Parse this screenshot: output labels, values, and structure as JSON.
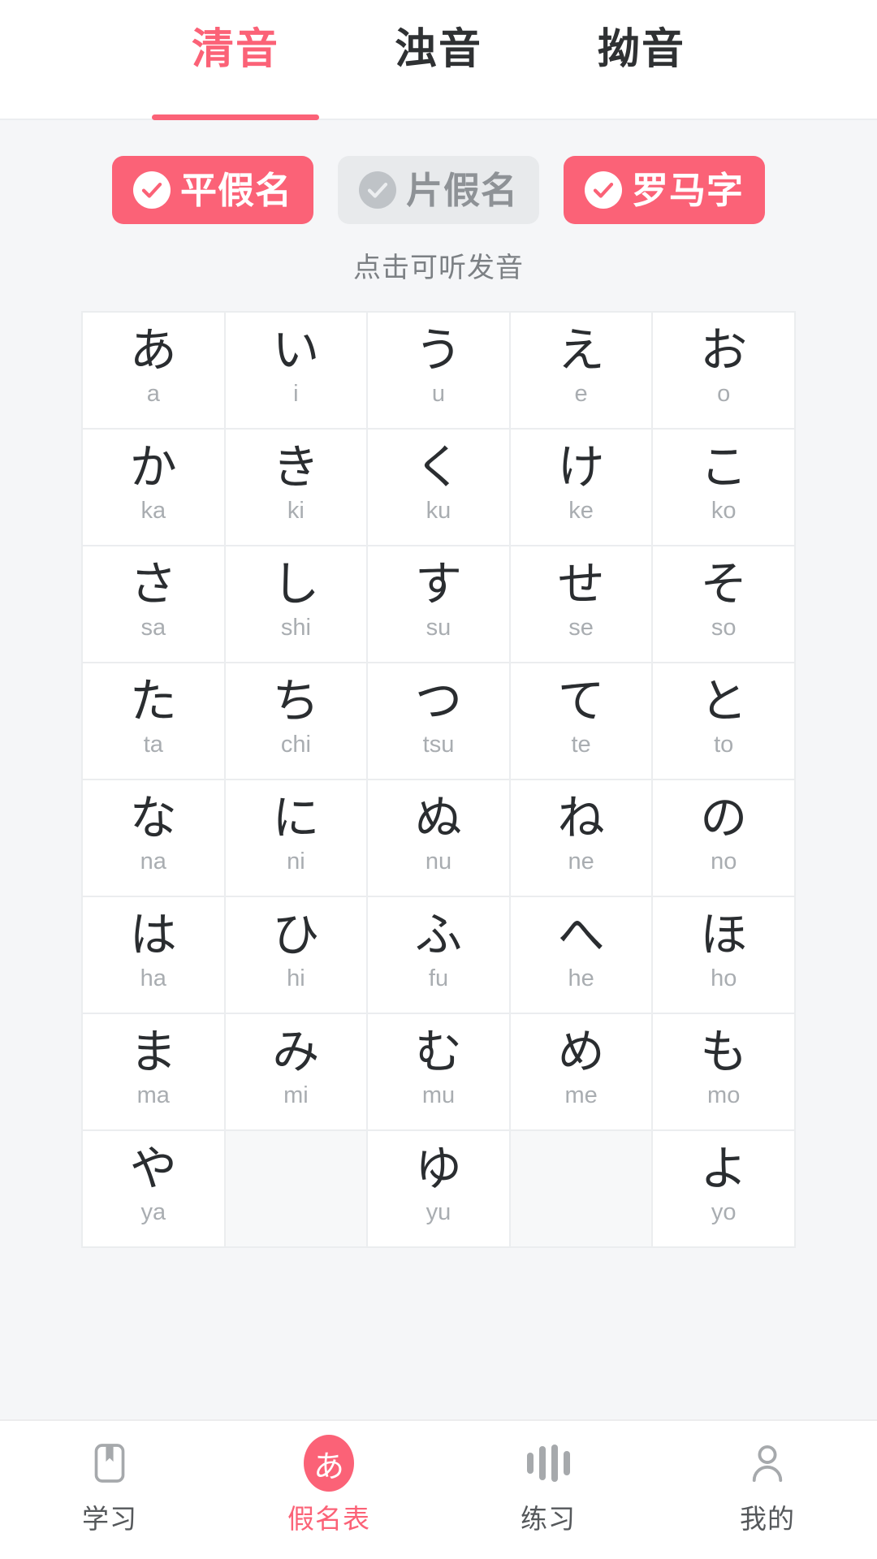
{
  "tabs": [
    {
      "label": "清音",
      "active": true
    },
    {
      "label": "浊音",
      "active": false
    },
    {
      "label": "拗音",
      "active": false
    }
  ],
  "filters": [
    {
      "label": "平假名",
      "selected": true,
      "icon": "check-circle-icon"
    },
    {
      "label": "片假名",
      "selected": false,
      "icon": "check-circle-icon"
    },
    {
      "label": "罗马字",
      "selected": true,
      "icon": "check-circle-icon"
    }
  ],
  "hint": "点击可听发音",
  "colors": {
    "accent": "#fb6277",
    "chip_off_bg": "#e8eaec",
    "chip_off_text": "#8e9296",
    "kana_text": "#2a2d30",
    "romaji_text": "#a9adb1",
    "page_bg": "#f5f6f8",
    "empty_cell_bg": "#f7f8f9"
  },
  "grid": {
    "columns": 5,
    "rows": [
      [
        {
          "kana": "あ",
          "romaji": "a"
        },
        {
          "kana": "い",
          "romaji": "i"
        },
        {
          "kana": "う",
          "romaji": "u"
        },
        {
          "kana": "え",
          "romaji": "e"
        },
        {
          "kana": "お",
          "romaji": "o"
        }
      ],
      [
        {
          "kana": "か",
          "romaji": "ka"
        },
        {
          "kana": "き",
          "romaji": "ki"
        },
        {
          "kana": "く",
          "romaji": "ku"
        },
        {
          "kana": "け",
          "romaji": "ke"
        },
        {
          "kana": "こ",
          "romaji": "ko"
        }
      ],
      [
        {
          "kana": "さ",
          "romaji": "sa"
        },
        {
          "kana": "し",
          "romaji": "shi"
        },
        {
          "kana": "す",
          "romaji": "su"
        },
        {
          "kana": "せ",
          "romaji": "se"
        },
        {
          "kana": "そ",
          "romaji": "so"
        }
      ],
      [
        {
          "kana": "た",
          "romaji": "ta"
        },
        {
          "kana": "ち",
          "romaji": "chi"
        },
        {
          "kana": "つ",
          "romaji": "tsu"
        },
        {
          "kana": "て",
          "romaji": "te"
        },
        {
          "kana": "と",
          "romaji": "to"
        }
      ],
      [
        {
          "kana": "な",
          "romaji": "na"
        },
        {
          "kana": "に",
          "romaji": "ni"
        },
        {
          "kana": "ぬ",
          "romaji": "nu"
        },
        {
          "kana": "ね",
          "romaji": "ne"
        },
        {
          "kana": "の",
          "romaji": "no"
        }
      ],
      [
        {
          "kana": "は",
          "romaji": "ha"
        },
        {
          "kana": "ひ",
          "romaji": "hi"
        },
        {
          "kana": "ふ",
          "romaji": "fu"
        },
        {
          "kana": "へ",
          "romaji": "he"
        },
        {
          "kana": "ほ",
          "romaji": "ho"
        }
      ],
      [
        {
          "kana": "ま",
          "romaji": "ma"
        },
        {
          "kana": "み",
          "romaji": "mi"
        },
        {
          "kana": "む",
          "romaji": "mu"
        },
        {
          "kana": "め",
          "romaji": "me"
        },
        {
          "kana": "も",
          "romaji": "mo"
        }
      ],
      [
        {
          "kana": "や",
          "romaji": "ya"
        },
        {
          "kana": "",
          "romaji": ""
        },
        {
          "kana": "ゆ",
          "romaji": "yu"
        },
        {
          "kana": "",
          "romaji": ""
        },
        {
          "kana": "よ",
          "romaji": "yo"
        }
      ]
    ]
  },
  "bottom_nav": [
    {
      "label": "学习",
      "icon": "book-icon",
      "active": false
    },
    {
      "label": "假名表",
      "icon": "kana-badge-icon",
      "badge_text": "あ",
      "active": true
    },
    {
      "label": "练习",
      "icon": "bars-icon",
      "active": false
    },
    {
      "label": "我的",
      "icon": "person-icon",
      "active": false
    }
  ]
}
